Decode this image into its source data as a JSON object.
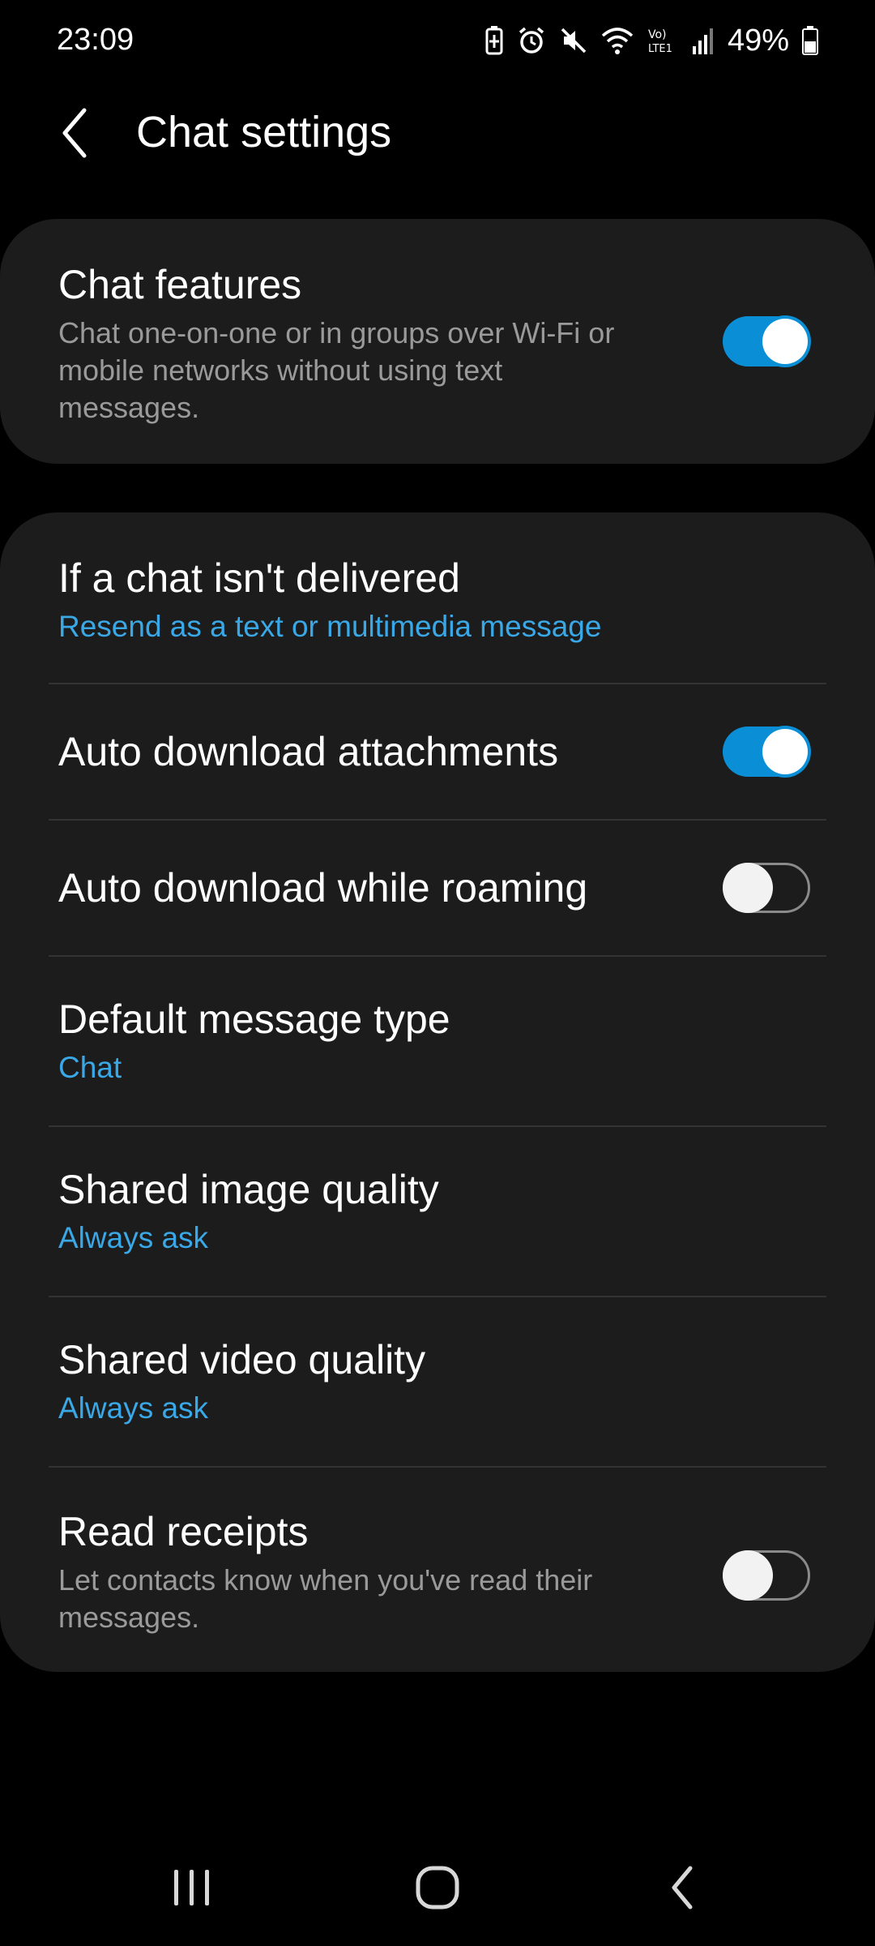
{
  "status_bar": {
    "time": "23:09",
    "battery_percent": "49%",
    "icons": [
      "battery-saver-icon",
      "alarm-icon",
      "mute-icon",
      "wifi-icon",
      "volte-icon",
      "signal-icon",
      "battery-icon"
    ]
  },
  "header": {
    "back_icon": "chevron-left-icon",
    "title": "Chat settings"
  },
  "chat_features": {
    "title": "Chat features",
    "description": "Chat one-on-one or in groups over Wi-Fi or mobile networks without using text messages.",
    "enabled": true
  },
  "settings": {
    "undelivered": {
      "title": "If a chat isn't delivered",
      "value": "Resend as a text or multimedia message"
    },
    "auto_download": {
      "title": "Auto download attachments",
      "enabled": true
    },
    "auto_download_roaming": {
      "title": "Auto download while roaming",
      "enabled": false
    },
    "default_message_type": {
      "title": "Default message type",
      "value": "Chat"
    },
    "image_quality": {
      "title": "Shared image quality",
      "value": "Always ask"
    },
    "video_quality": {
      "title": "Shared video quality",
      "value": "Always ask"
    },
    "read_receipts": {
      "title": "Read receipts",
      "description": "Let contacts know when you've read their messages.",
      "enabled": false
    }
  },
  "nav_bar": {
    "icons": [
      "recent-apps-icon",
      "home-icon",
      "back-icon"
    ]
  },
  "colors": {
    "background": "#000000",
    "card": "#1c1c1c",
    "accent": "#0a8fd6",
    "link_text": "#3aa8e6",
    "secondary_text": "#9a9a9a"
  }
}
